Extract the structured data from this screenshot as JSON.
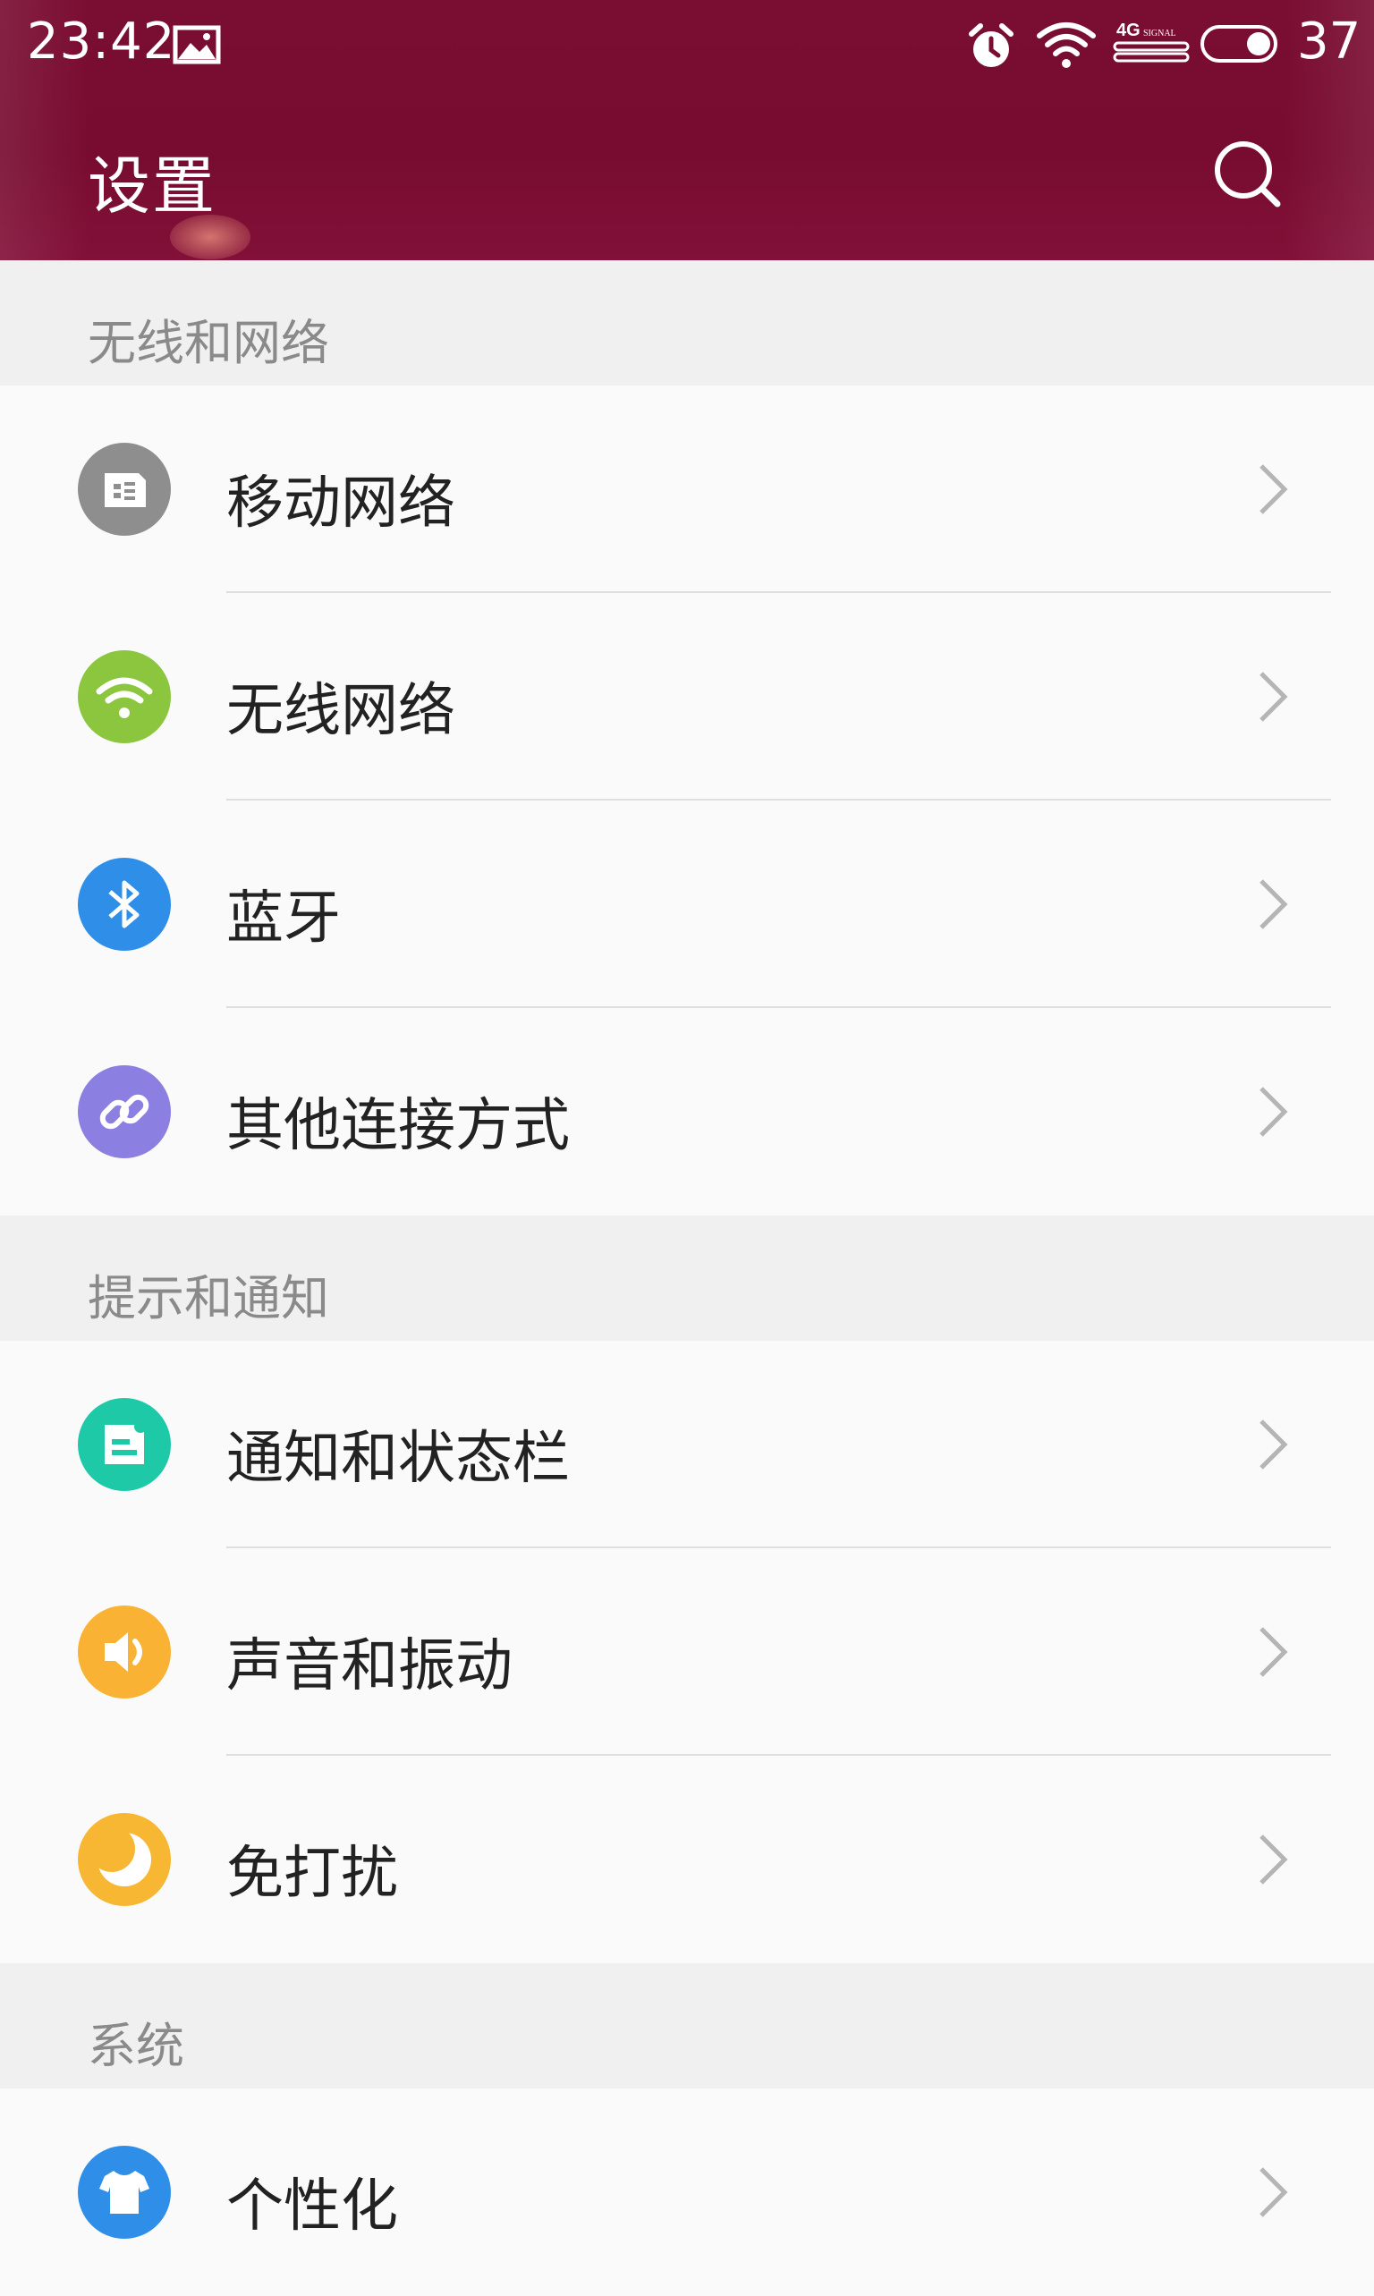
{
  "status_bar": {
    "time": "23:42",
    "network_label": "4G",
    "signal_label": "SIGNAL",
    "battery": "37",
    "icons": [
      "image-icon",
      "alarm-icon",
      "wifi-signal-icon",
      "cellular-signal-icon",
      "battery-toggle-icon"
    ]
  },
  "header": {
    "title": "设置",
    "search_icon": "search-icon",
    "accent_color": "#7a0d32"
  },
  "sections": [
    {
      "title": "无线和网络",
      "items": [
        {
          "label": "移动网络",
          "icon": "sim-card-icon",
          "color": "#8e8e8e"
        },
        {
          "label": "无线网络",
          "icon": "wifi-icon",
          "color": "#8cc63e"
        },
        {
          "label": "蓝牙",
          "icon": "bluetooth-icon",
          "color": "#2f8fe8"
        },
        {
          "label": "其他连接方式",
          "icon": "link-icon",
          "color": "#8b7fe2"
        }
      ]
    },
    {
      "title": "提示和通知",
      "items": [
        {
          "label": "通知和状态栏",
          "icon": "notification-icon",
          "color": "#1ec9a7"
        },
        {
          "label": "声音和振动",
          "icon": "speaker-icon",
          "color": "#f9b233"
        },
        {
          "label": "免打扰",
          "icon": "moon-icon",
          "color": "#f7b733"
        }
      ]
    },
    {
      "title": "系统",
      "items": [
        {
          "label": "个性化",
          "icon": "tshirt-icon",
          "color": "#2f8fe8"
        }
      ]
    }
  ]
}
